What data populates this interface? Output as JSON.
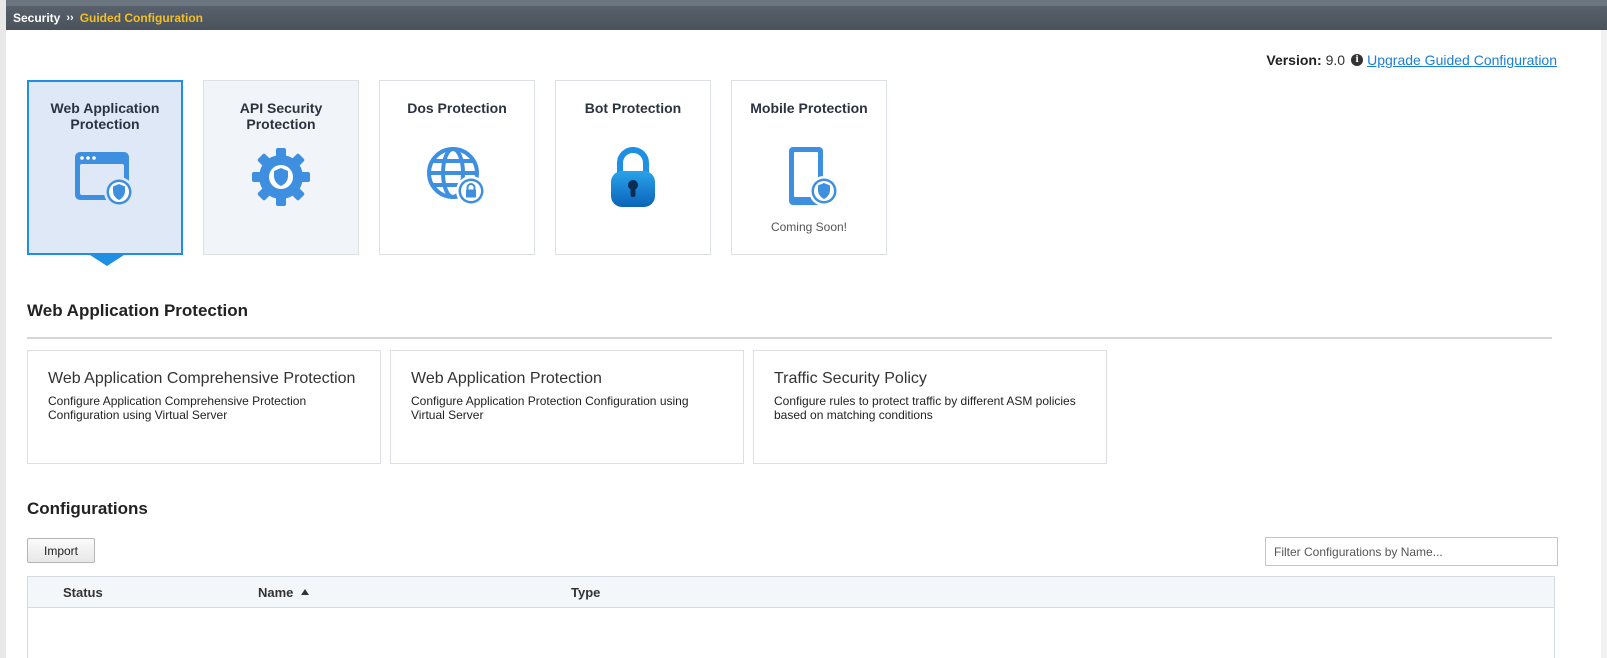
{
  "breadcrumb": {
    "root": "Security",
    "separator": "››",
    "current": "Guided Configuration"
  },
  "version": {
    "label": "Version:",
    "value": "9.0",
    "info_icon": "info-icon",
    "upgrade_link": "Upgrade Guided Configuration"
  },
  "categories": [
    {
      "title": "Web Application Protection",
      "icon": "browser-shield-icon",
      "active": true
    },
    {
      "title": "API Security Protection",
      "icon": "gear-shield-icon"
    },
    {
      "title": "Dos Protection",
      "icon": "globe-lock-icon"
    },
    {
      "title": "Bot Protection",
      "icon": "padlock-icon"
    },
    {
      "title": "Mobile Protection",
      "icon": "mobile-shield-icon",
      "note": "Coming Soon!"
    }
  ],
  "section": {
    "title": "Web Application Protection"
  },
  "options": [
    {
      "title": "Web Application Comprehensive Protection",
      "description": "Configure Application Comprehensive Protection Configuration using Virtual Server"
    },
    {
      "title": "Web Application Protection",
      "description": "Configure Application Protection Configuration using Virtual Server"
    },
    {
      "title": "Traffic Security Policy",
      "description": "Configure rules to protect traffic by different ASM policies based on matching conditions"
    }
  ],
  "configurations": {
    "title": "Configurations",
    "import_label": "Import",
    "filter_placeholder": "Filter Configurations by Name...",
    "columns": [
      "Status",
      "Name",
      "Type"
    ],
    "sort_icon": "sort-ascending-icon"
  },
  "colors": {
    "accent": "#1e8fe3",
    "breadcrumb_current": "#f4bf24",
    "topbar": "#4a525b",
    "link": "#1a7fd6",
    "icon_blue": "#3f8fe0"
  }
}
